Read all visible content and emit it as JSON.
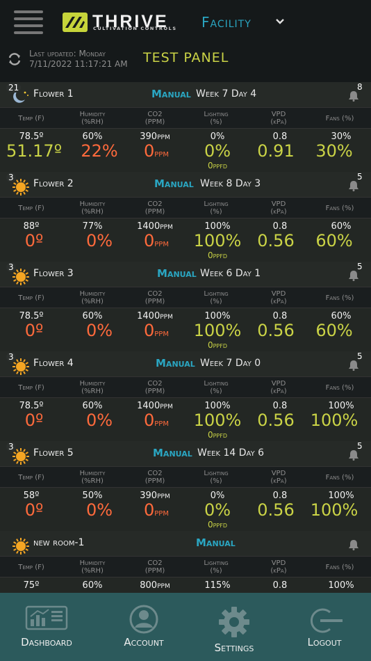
{
  "header": {
    "brand": "THRIVE",
    "brand_sub": "CULTIVATION CONTROLS",
    "facility_label": "Facility",
    "last_updated_line1": "Last updated: Monday",
    "last_updated_line2": "7/11/2022 11:17:21 AM",
    "panel_title": "TEST PANEL"
  },
  "labels": {
    "temp": "Temp (F)",
    "humidity_1": "Humidity",
    "humidity_2": "(%RH)",
    "co2_1": "CO2",
    "co2_2": "(PPM)",
    "lighting_1": "Lighting",
    "lighting_2": "(%)",
    "vpd_1": "VPD",
    "vpd_2": "(kPa)",
    "fans": "Fans (%)"
  },
  "rooms": [
    {
      "badge": "21",
      "icon": "moon-icon",
      "name": "Flower 1",
      "mode": "Manual",
      "week": "Week 7 Day 4",
      "alerts": "8",
      "temp_set": "78.5º",
      "temp_val": "51.17º",
      "temp_color": "yellow",
      "hum_set": "60%",
      "hum_val": "22%",
      "hum_color": "orange",
      "co2_set": "390",
      "co2_set_unit": "ppm",
      "co2_val": "0",
      "co2_unit": "ppm",
      "light_set": "0%",
      "light_val": "0%",
      "ppfd": "0",
      "ppfd_unit": "ppfd",
      "vpd_set": "0.8",
      "vpd_val": "0.91",
      "fans_set": "30%",
      "fans_val": "30%"
    },
    {
      "badge": "3",
      "icon": "sun-icon",
      "name": "Flower 2",
      "mode": "Manual",
      "week": "Week 8 Day 3",
      "alerts": "5",
      "temp_set": "88º",
      "temp_val": "0º",
      "temp_color": "orange",
      "hum_set": "77%",
      "hum_val": "0%",
      "hum_color": "orange",
      "co2_set": "1400",
      "co2_set_unit": "ppm",
      "co2_val": "0",
      "co2_unit": "ppm",
      "light_set": "100%",
      "light_val": "100%",
      "ppfd": "0",
      "ppfd_unit": "ppfd",
      "vpd_set": "0.8",
      "vpd_val": "0.56",
      "fans_set": "60%",
      "fans_val": "60%"
    },
    {
      "badge": "3",
      "icon": "sun-icon",
      "name": "Flower 3",
      "mode": "Manual",
      "week": "Week 6 Day 1",
      "alerts": "5",
      "temp_set": "78.5º",
      "temp_val": "0º",
      "temp_color": "orange",
      "hum_set": "60%",
      "hum_val": "0%",
      "hum_color": "orange",
      "co2_set": "1400",
      "co2_set_unit": "ppm",
      "co2_val": "0",
      "co2_unit": "ppm",
      "light_set": "100%",
      "light_val": "100%",
      "ppfd": "0",
      "ppfd_unit": "ppfd",
      "vpd_set": "0.8",
      "vpd_val": "0.56",
      "fans_set": "60%",
      "fans_val": "60%"
    },
    {
      "badge": "3",
      "icon": "sun-icon",
      "name": "Flower 4",
      "mode": "Manual",
      "week": "Week 7 Day 0",
      "alerts": "5",
      "temp_set": "78.5º",
      "temp_val": "0º",
      "temp_color": "orange",
      "hum_set": "60%",
      "hum_val": "0%",
      "hum_color": "orange",
      "co2_set": "1400",
      "co2_set_unit": "ppm",
      "co2_val": "0",
      "co2_unit": "ppm",
      "light_set": "100%",
      "light_val": "100%",
      "ppfd": "0",
      "ppfd_unit": "ppfd",
      "vpd_set": "0.8",
      "vpd_val": "0.56",
      "fans_set": "100%",
      "fans_val": "100%"
    },
    {
      "badge": "3",
      "icon": "sun-icon",
      "name": "Flower 5",
      "mode": "Manual",
      "week": "Week 14 Day 6",
      "alerts": "5",
      "temp_set": "58º",
      "temp_val": "0º",
      "temp_color": "orange",
      "hum_set": "50%",
      "hum_val": "0%",
      "hum_color": "orange",
      "co2_set": "390",
      "co2_set_unit": "ppm",
      "co2_val": "0",
      "co2_unit": "ppm",
      "light_set": "0%",
      "light_val": "0%",
      "ppfd": "0",
      "ppfd_unit": "ppfd",
      "vpd_set": "0.8",
      "vpd_val": "0.56",
      "fans_set": "100%",
      "fans_val": "100%"
    },
    {
      "badge": "",
      "icon": "sun-icon",
      "name": "new room-1",
      "mode": "Manual",
      "week": "",
      "alerts": "",
      "temp_set": "75º",
      "temp_val": "",
      "temp_color": "orange",
      "hum_set": "60%",
      "hum_val": "",
      "hum_color": "orange",
      "co2_set": "800",
      "co2_set_unit": "ppm",
      "co2_val": "",
      "co2_unit": "",
      "light_set": "115%",
      "light_val": "",
      "ppfd": "",
      "ppfd_unit": "",
      "vpd_set": "0.8",
      "vpd_val": "",
      "fans_set": "100%",
      "fans_val": ""
    }
  ],
  "nav": {
    "dashboard": "Dashboard",
    "account": "Account",
    "settings": "Settings",
    "logout": "Logout"
  },
  "colors": {
    "accent": "#2aa6c2",
    "yellow": "#cad346",
    "orange": "#ff6a3c",
    "nav_bg": "#2c5a5c"
  }
}
